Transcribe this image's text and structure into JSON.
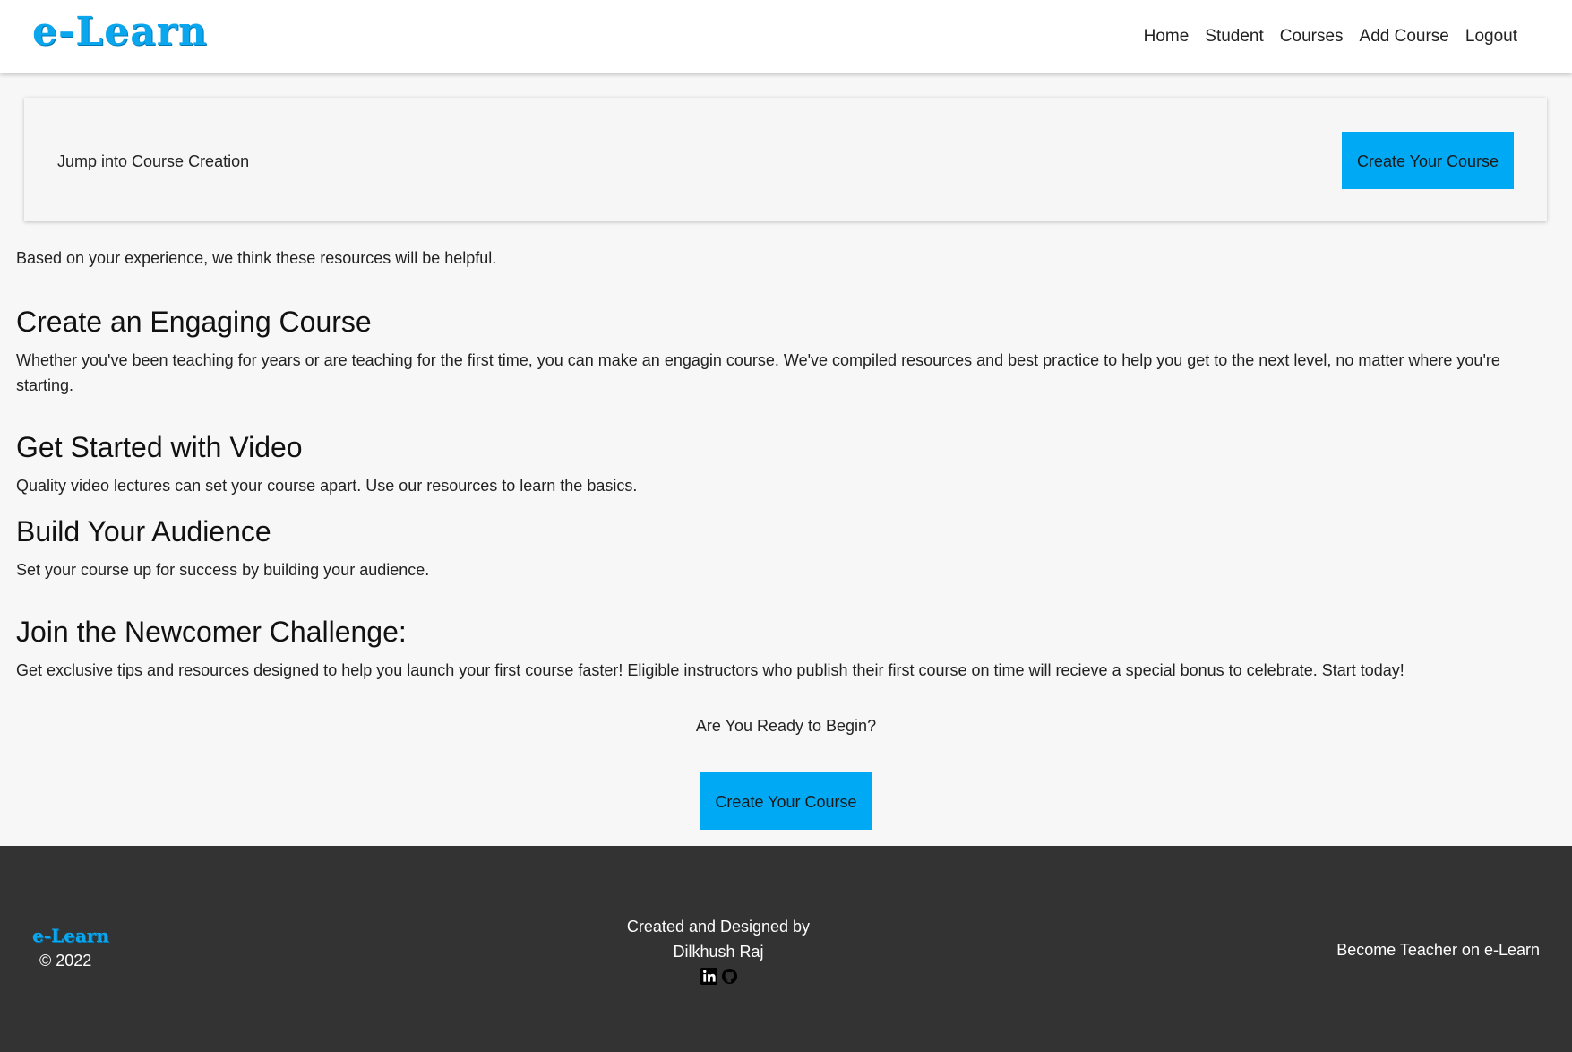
{
  "brand": {
    "logo_text": "e-Learn",
    "accent_color": "#00a9f4"
  },
  "nav": {
    "items": [
      {
        "label": "Home"
      },
      {
        "label": "Student"
      },
      {
        "label": "Courses"
      },
      {
        "label": "Add Course"
      },
      {
        "label": "Logout"
      }
    ]
  },
  "hero": {
    "text": "Jump into Course Creation",
    "button_label": "Create Your Course"
  },
  "intro": "Based on your experience, we think these resources will be helpful.",
  "sections": [
    {
      "title": "Create an Engaging Course",
      "body": "Whether you've been teaching for years or are teaching for the first time, you can make an engagin course. We've compiled resources and best practice to help you get to the next level, no matter where you're starting."
    },
    {
      "title": "Get Started with Video",
      "body": "Quality video lectures can set your course apart. Use our resources to learn the basics."
    },
    {
      "title": "Build Your Audience",
      "body": "Set your course up for success by building your audience."
    },
    {
      "title": "Join the Newcomer Challenge:",
      "body": "Get exclusive tips and resources designed to help you launch your first course faster! Eligible instructors who publish their first course on time will recieve a special bonus to celebrate. Start today!"
    }
  ],
  "cta": {
    "question": "Are You Ready to Begin?",
    "button_label": "Create Your Course"
  },
  "footer": {
    "logo_text": "e-Learn",
    "copyright": "© 2022",
    "credit_line1": "Created and Designed by",
    "credit_line2": "Dilkhush Raj",
    "social_icons": [
      "linkedin-icon",
      "github-icon"
    ],
    "become_teacher": "Become Teacher on e-Learn",
    "background_color": "#333333"
  }
}
